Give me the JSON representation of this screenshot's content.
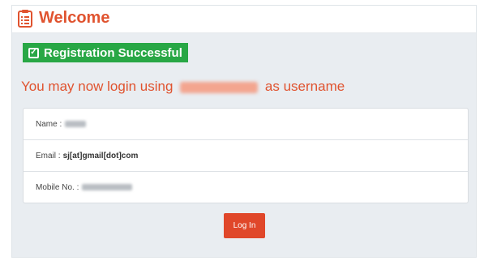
{
  "header": {
    "title": "Welcome",
    "icon": "clipboard-list-icon"
  },
  "badge": {
    "label": "Registration Successful",
    "icon": "check-square-icon"
  },
  "message": {
    "prefix": "You may now login using",
    "suffix": "as username"
  },
  "details": {
    "name_label": "Name :",
    "email_label": "Email :",
    "email_value": "sj[at]gmail[dot]com",
    "mobile_label": "Mobile No. :"
  },
  "login_button": {
    "label": "Log In"
  },
  "colors": {
    "accent": "#e0532f",
    "success": "#28a745",
    "button": "#e0472a"
  }
}
